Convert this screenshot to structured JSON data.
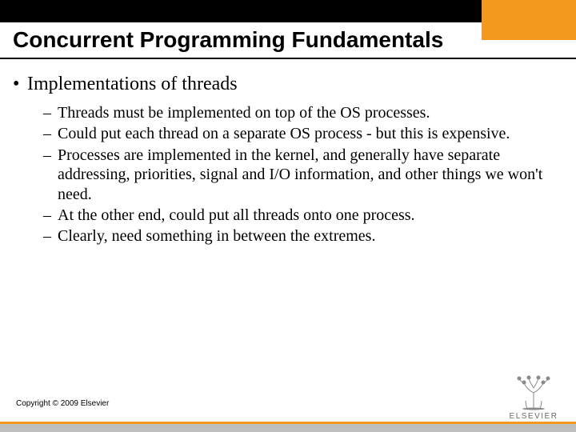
{
  "header": {
    "title": "Concurrent Programming Fundamentals"
  },
  "content": {
    "lvl1": "Implementations of threads",
    "lvl2": [
      "Threads must be implemented on top of the OS processes.",
      "Could put each thread on a separate OS process - but this is expensive.",
      "Processes are implemented in the kernel, and generally have separate addressing, priorities, signal and I/O information, and other things we won't need.",
      "At the other end, could put all threads onto one process.",
      "Clearly, need something in between the extremes."
    ]
  },
  "footer": {
    "copyright": "Copyright © 2009 Elsevier",
    "logo_text": "ELSEVIER"
  }
}
